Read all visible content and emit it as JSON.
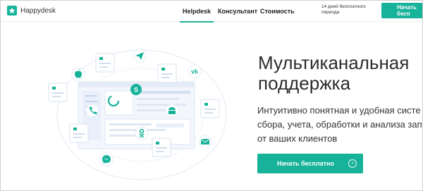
{
  "header": {
    "logo_text": "Happydesk",
    "nav": [
      {
        "label": "Helpdesk",
        "active": true
      },
      {
        "label": "Консультант",
        "active": false
      },
      {
        "label": "Стоимость",
        "active": false
      }
    ],
    "trial_text": "14 дней бесплатного периода",
    "cta_label": "Начать бесп"
  },
  "hero": {
    "title_line1": "Мультиканальная",
    "title_line2": "поддержка",
    "text_line1": "Интуитивно понятная и удобная систе",
    "text_line2": "сбора, учета, обработки и анализа запр",
    "text_line3": "от ваших клиентов",
    "cta_label": "Начать бесплатно",
    "cta_icon": "arrow-right-circle-icon"
  },
  "colors": {
    "accent": "#17b29a",
    "illustration_light": "#e9f0fb",
    "illustration_mid": "#c9d6ea"
  },
  "illustration": {
    "channel_icons": [
      "telegram-icon",
      "apple-icon",
      "vk-icon",
      "skype-icon",
      "phone-icon",
      "android-icon",
      "odnoklassniki-icon",
      "mail-icon",
      "messenger-icon"
    ]
  }
}
